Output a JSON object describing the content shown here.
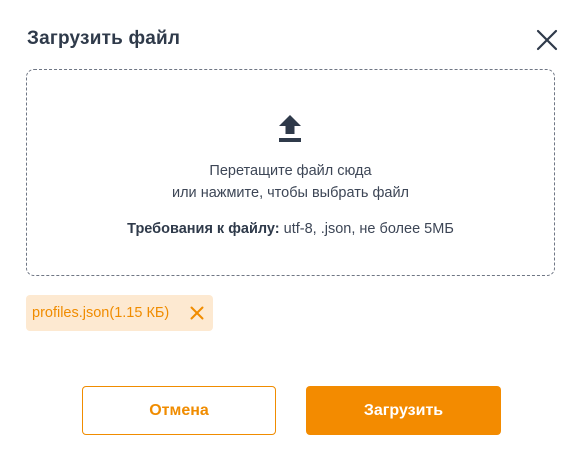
{
  "dialog": {
    "title": "Загрузить файл",
    "close_icon": "close-icon"
  },
  "dropzone": {
    "icon": "upload-icon",
    "line1": "Перетащите файл сюда",
    "line2": "или нажмите, чтобы выбрать файл",
    "requirements_label": "Требования к файлу:",
    "requirements_value": " utf-8, .json, не более 5МБ"
  },
  "file": {
    "name": "profiles.json(1.15 КБ)",
    "remove_icon": "close-icon"
  },
  "buttons": {
    "cancel": "Отмена",
    "upload": "Загрузить"
  },
  "colors": {
    "accent": "#f38b00",
    "chip_bg": "#fde9d1",
    "text": "#2f3a4a"
  }
}
